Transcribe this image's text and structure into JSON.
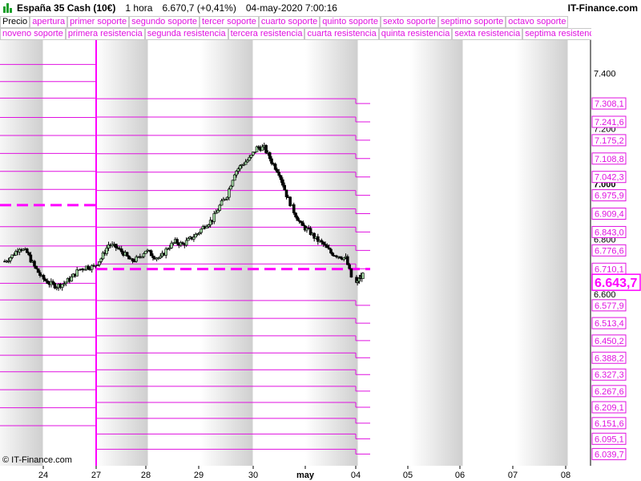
{
  "header": {
    "instrument": "España 35 Cash (10€)",
    "timeframe": "1 hora",
    "price_change": "6.670,7 (+0,41%)",
    "datetime": "04-may-2020 7:00:16",
    "brand": "IT-Finance.com",
    "copyright": "© IT-Finance.com"
  },
  "legend": {
    "row1": [
      "Precio",
      "apertura",
      "primer soporte",
      "segundo soporte",
      "tercer soporte",
      "cuarto soporte",
      "quinto soporte",
      "sexto soporte",
      "septimo soporte",
      "octavo soporte"
    ],
    "row2": [
      "noveno soporte",
      "primera resistencia",
      "segunda resistencia",
      "tercera resistencia",
      "cuarta resistencia",
      "quinta resistencia",
      "sexta resistencia",
      "septima resistenc"
    ]
  },
  "colors": {
    "magenta": "#ff00ff",
    "lines": "#e010e0",
    "band": "#cfcfcf",
    "candle_up": "#9fd39f",
    "candle_down": "#000000"
  },
  "chart_data": {
    "type": "candlestick",
    "ylim": [
      5.98,
      7.52
    ],
    "y_ticks": [
      {
        "value": 7.4,
        "label": "7.400"
      },
      {
        "value": 7.2,
        "label": "7.200"
      },
      {
        "value": 7.0,
        "label": "7.000"
      },
      {
        "value": 6.8,
        "label": "6.800"
      },
      {
        "value": 6.6,
        "label": "6.600"
      }
    ],
    "x_labels": [
      "24",
      "27",
      "28",
      "29",
      "30",
      "may",
      "04",
      "05",
      "06",
      "07",
      "08"
    ],
    "last_price": {
      "value": 6.6437,
      "label": "6.643,7"
    },
    "opening_previous": 6.923,
    "opening_current": 6.6915,
    "levels_current": [
      7.3081,
      7.2416,
      7.1752,
      7.1088,
      7.0423,
      6.9759,
      6.9094,
      6.843,
      6.7766,
      6.7101,
      6.5779,
      6.5134,
      6.4503,
      6.3882,
      6.3273,
      6.2676,
      6.2091,
      6.1516,
      6.0951,
      6.0397
    ],
    "level_labels": [
      "7.308,1",
      "7.241,6",
      "7.175,2",
      "7.108,8",
      "7.042,3",
      "6.975,9",
      "6.909,4",
      "6.843,0",
      "6.776,6",
      "6.710,1",
      "6.577,9",
      "6.513,4",
      "6.450,2",
      "6.388,2",
      "6.327,3",
      "6.267,6",
      "6.209,1",
      "6.151,6",
      "6.095,1",
      "6.039,7"
    ],
    "levels_previous": [
      7.432,
      7.37,
      7.31,
      7.24,
      7.175,
      7.11,
      7.045,
      6.98,
      6.845,
      6.775,
      6.7,
      6.64,
      6.58,
      6.51,
      6.445,
      6.38,
      6.32,
      6.255,
      6.19,
      6.125
    ],
    "price_path": [
      [
        0,
        6.72
      ],
      [
        1,
        6.74
      ],
      [
        2,
        6.77
      ],
      [
        3,
        6.75
      ],
      [
        4,
        6.7
      ],
      [
        5,
        6.66
      ],
      [
        6,
        6.64
      ],
      [
        7,
        6.63
      ],
      [
        8,
        6.64
      ],
      [
        9,
        6.66
      ],
      [
        10,
        6.69
      ],
      [
        11,
        6.7
      ],
      [
        12,
        6.7
      ],
      [
        13,
        6.73
      ],
      [
        14,
        6.78
      ],
      [
        15,
        6.77
      ],
      [
        16,
        6.75
      ],
      [
        17,
        6.72
      ],
      [
        18,
        6.73
      ],
      [
        19,
        6.76
      ],
      [
        20,
        6.74
      ],
      [
        21,
        6.73
      ],
      [
        22,
        6.77
      ],
      [
        23,
        6.79
      ],
      [
        24,
        6.78
      ],
      [
        25,
        6.8
      ],
      [
        26,
        6.82
      ],
      [
        27,
        6.85
      ],
      [
        28,
        6.87
      ],
      [
        29,
        6.92
      ],
      [
        30,
        6.96
      ],
      [
        31,
        7.04
      ],
      [
        32,
        7.07
      ],
      [
        33,
        7.09
      ],
      [
        34,
        7.13
      ],
      [
        35,
        7.13
      ],
      [
        36,
        7.08
      ],
      [
        37,
        7.04
      ],
      [
        38,
        6.96
      ],
      [
        39,
        6.9
      ],
      [
        40,
        6.85
      ],
      [
        41,
        6.83
      ],
      [
        42,
        6.8
      ],
      [
        43,
        6.78
      ],
      [
        44,
        6.75
      ],
      [
        45,
        6.74
      ],
      [
        46,
        6.73
      ],
      [
        47,
        6.64
      ],
      [
        48,
        6.66
      ],
      [
        49,
        6.67
      ]
    ]
  }
}
